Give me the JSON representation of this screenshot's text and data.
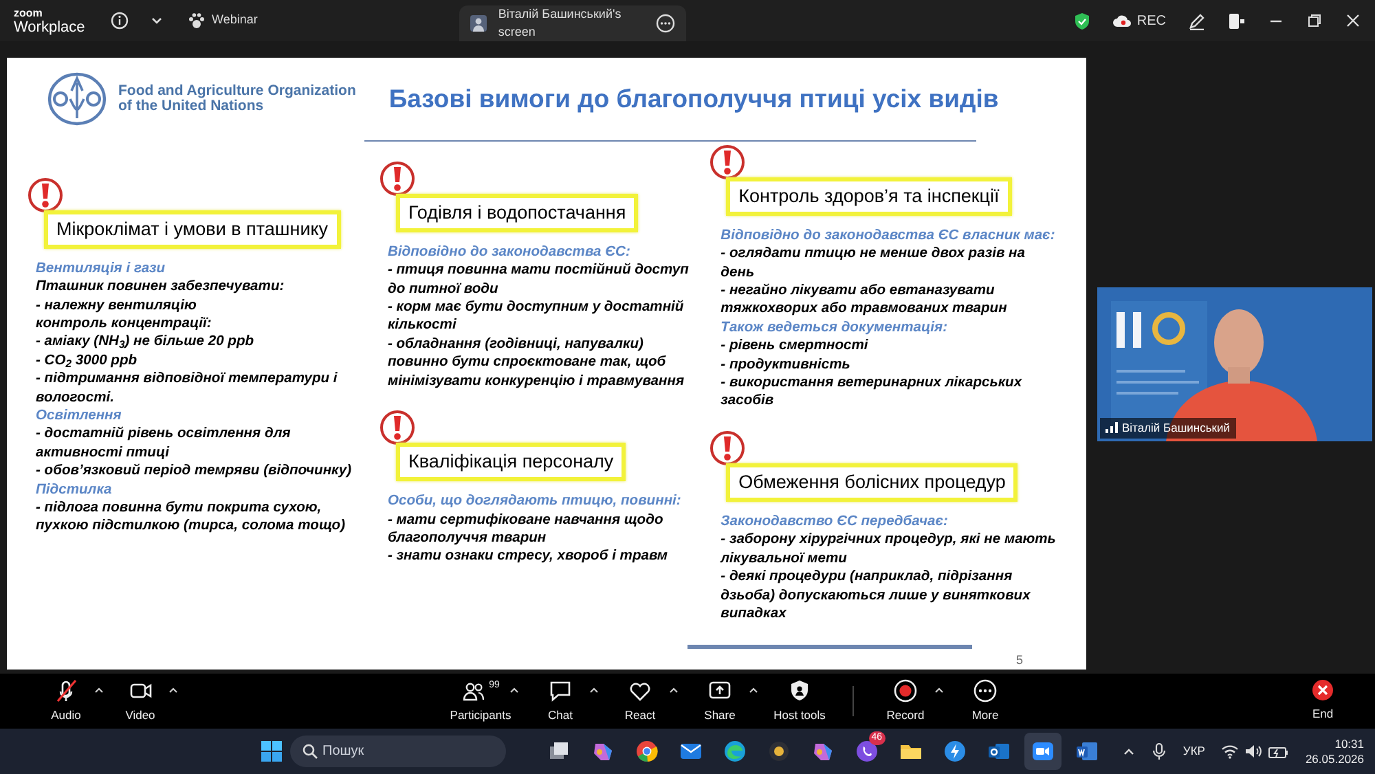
{
  "title_bar": {
    "logo_lines": [
      "zoom",
      "Workplace"
    ],
    "meeting_type": "Webinar",
    "share_tab": {
      "label": "Віталій Башинський's screen",
      "selected": true
    },
    "recording_label": "REC"
  },
  "slide": {
    "org_name_lines": [
      "Food and Agriculture Organization",
      "of the United Nations"
    ],
    "title": "Базові вимоги до благополуччя птиці усіх видів",
    "columns": [
      {
        "sections": [
          {
            "heading": "Мікроклімат і умови в пташнику",
            "lines": [
              {
                "kind": "subhead",
                "text": "Вентиляція і гази"
              },
              {
                "kind": "item",
                "text": "Пташник повинен забезпечувати:"
              },
              {
                "kind": "item",
                "text": "- належну вентиляцію"
              },
              {
                "kind": "item",
                "text": "контроль концентрації:"
              },
              {
                "kind": "item",
                "text": "- аміаку (NH$_{3}$) не більше 20 ppb"
              },
              {
                "kind": "item",
                "text": "- CO$_{2}$ 3000 ppb"
              },
              {
                "kind": "item",
                "text": "- підтримання відповідної температури і вологості."
              },
              {
                "kind": "subhead",
                "text": "Освітлення"
              },
              {
                "kind": "item",
                "text": "- достатній рівень освітлення для активності птиці"
              },
              {
                "kind": "item",
                "text": "- обов’язковий період темряви (відпочинку)"
              },
              {
                "kind": "subhead",
                "text": "Підстилка"
              },
              {
                "kind": "item",
                "text": "- підлога повинна бути покрита сухою, пухкою підстилкою (тирса, солома тощо)"
              }
            ]
          }
        ]
      },
      {
        "sections": [
          {
            "heading": "Годівля і водопостачання",
            "lines": [
              {
                "kind": "subhead",
                "text": "Відповідно до законодавства ЄС:"
              },
              {
                "kind": "item",
                "text": "- птиця повинна мати постійний доступ до питної води"
              },
              {
                "kind": "item",
                "text": "- корм має бути доступним у достатній кількості"
              },
              {
                "kind": "item",
                "text": "- обладнання (годівниці, напувалки) повинно бути спроєктоване так, щоб мінімізувати конкуренцію і травмування"
              }
            ]
          },
          {
            "heading": "Кваліфікація персоналу",
            "lines": [
              {
                "kind": "subhead",
                "text": "Особи, що доглядають птицю, повинні:"
              },
              {
                "kind": "item",
                "text": "- мати сертифіковане навчання щодо благополуччя тварин"
              },
              {
                "kind": "item",
                "text": "- знати ознаки стресу, хвороб і травм"
              }
            ]
          }
        ]
      },
      {
        "sections": [
          {
            "heading": "Контроль здоров’я та інспекції",
            "lines": [
              {
                "kind": "subhead",
                "text": "Відповідно до законодавства ЄС власник має:"
              },
              {
                "kind": "item",
                "text": "- оглядати птицю не менше двох разів на день"
              },
              {
                "kind": "item",
                "text": "- негайно лікувати або евтаназувати тяжкохворих або травмованих тварин"
              },
              {
                "kind": "subhead",
                "text": "Також ведеться документація:"
              },
              {
                "kind": "item",
                "text": "- рівень смертності"
              },
              {
                "kind": "item",
                "text": "- продуктивність"
              },
              {
                "kind": "item",
                "text": "- використання ветеринарних лікарських засобів"
              }
            ]
          },
          {
            "heading": "Обмеження болісних процедур",
            "lines": [
              {
                "kind": "subhead",
                "text": "Законодавство ЄС передбачає:"
              },
              {
                "kind": "item",
                "text": "- заборону хірургічних процедур, які не мають лікувальної мети"
              },
              {
                "kind": "item",
                "text": "- деякі процедури (наприклад, підрізання дзьоба) допускаються лише у виняткових випадках"
              }
            ]
          }
        ]
      }
    ],
    "page_number": "5"
  },
  "video_tile": {
    "participant_name": "Віталій Башинський"
  },
  "toolbar": {
    "left_items": [
      {
        "kind": "audio",
        "label": "Audio",
        "muted": true,
        "has_menu": true
      },
      {
        "kind": "video",
        "label": "Video",
        "muted": false,
        "has_menu": true
      }
    ],
    "center_items": [
      {
        "kind": "participants",
        "label": "Participants",
        "count": "99",
        "has_menu": true
      },
      {
        "kind": "chat",
        "label": "Chat",
        "has_menu": true
      },
      {
        "kind": "react",
        "label": "React",
        "has_menu": true
      },
      {
        "kind": "share",
        "label": "Share",
        "has_menu": true
      },
      {
        "kind": "host",
        "label": "Host tools",
        "has_menu": false
      }
    ],
    "recording_items": [
      {
        "kind": "record",
        "label": "Record",
        "has_menu": true
      },
      {
        "kind": "more",
        "label": "More",
        "has_menu": false
      }
    ],
    "end_label": "End"
  },
  "taskbar": {
    "search": {
      "placeholder": "Пошук"
    },
    "apps": [
      {
        "kind": "taskview",
        "selected": false
      },
      {
        "kind": "copilot",
        "selected": false
      },
      {
        "kind": "chrome",
        "selected": false
      },
      {
        "kind": "mail",
        "selected": false
      },
      {
        "kind": "edge",
        "selected": false
      },
      {
        "kind": "camera",
        "selected": false
      },
      {
        "kind": "copilot",
        "selected": false
      },
      {
        "kind": "viber",
        "badge": "46",
        "selected": false
      },
      {
        "kind": "folder",
        "selected": false
      },
      {
        "kind": "bolt",
        "selected": false
      },
      {
        "kind": "outlook",
        "selected": false
      },
      {
        "kind": "zoom",
        "selected": true
      },
      {
        "kind": "word",
        "selected": false
      }
    ],
    "language": "УКР",
    "time": "10:31",
    "date": "26.05.2026"
  }
}
